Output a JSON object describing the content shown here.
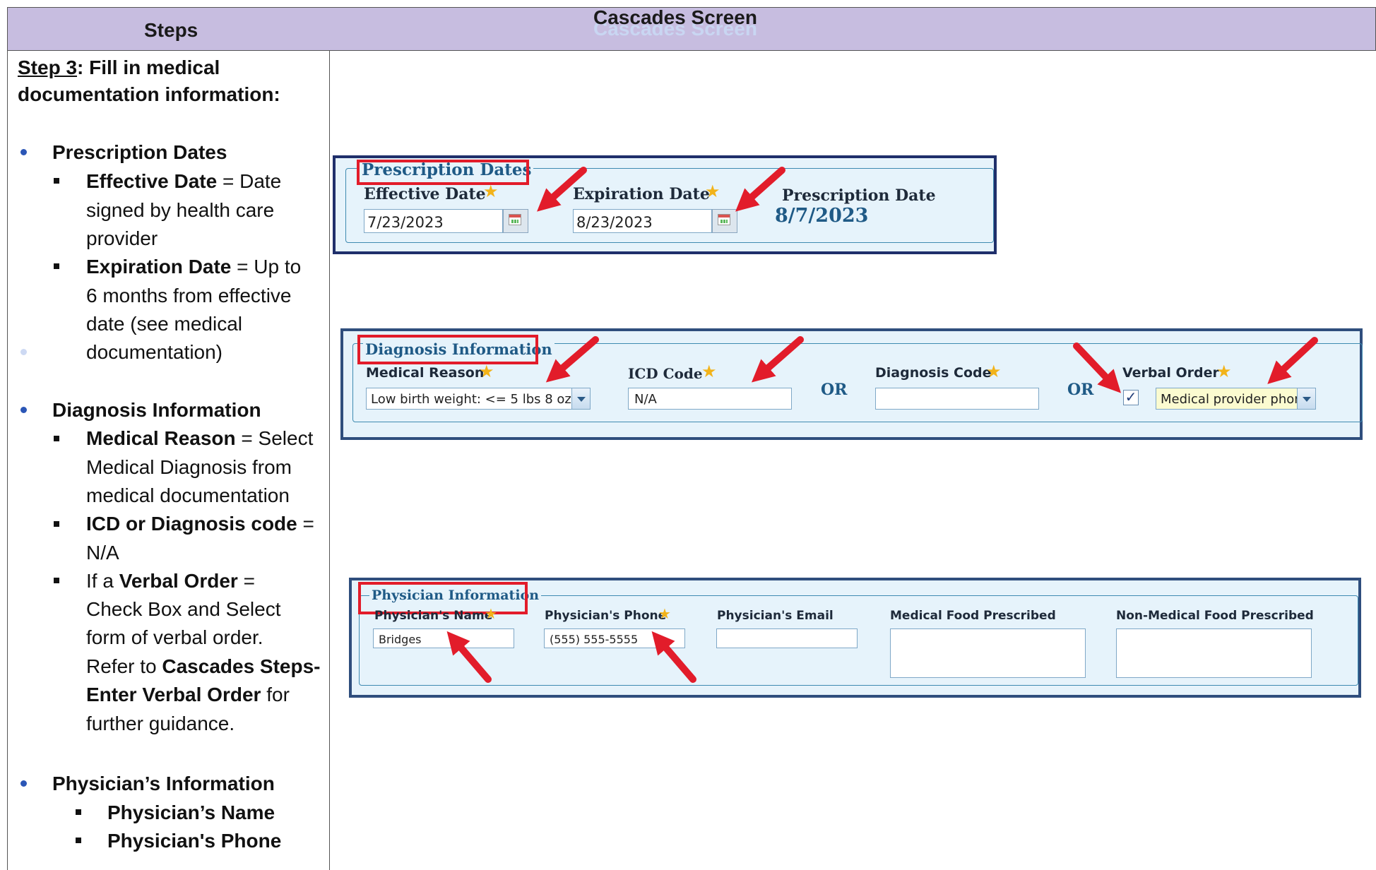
{
  "header": {
    "steps": "Steps",
    "screen": "Cascades Screen"
  },
  "left": {
    "step_label": "Step 3",
    "step_rest": ": Fill in medical",
    "step_line2": "documentation information:",
    "rx_dates": "Prescription Dates",
    "eff_bold": "Effective Date",
    "eff_rest": " = Date",
    "eff_l2": "signed by health care",
    "eff_l3": "provider",
    "exp_bold": "Expiration Date",
    "exp_rest": " = Up to",
    "exp_l2": "6 months from effective",
    "exp_l3": "date (see medical",
    "exp_l4": "documentation)",
    "diag_info": "Diagnosis Information",
    "mr_bold": "Medical Reason",
    "mr_rest": " = Select",
    "mr_l2": "Medical Diagnosis from",
    "mr_l3": "medical documentation",
    "icd_bold": "ICD or Diagnosis code",
    "icd_rest": " =",
    "icd_l2": "N/A",
    "vo_pre": "If a ",
    "vo_bold": "Verbal Order",
    "vo_rest": " =",
    "vo_l2": "Check Box and Select",
    "vo_l3": "form of verbal order.",
    "vo_l4_pre": "Refer to ",
    "vo_l4_bold": "Cascades Steps-",
    "vo_l5_bold": "Enter Verbal Order",
    "vo_l5_rest": " for",
    "vo_l6": "further guidance.",
    "phys_info": "Physician’s Information",
    "phys_name": "Physician’s Name",
    "phys_phone": "Physician's Phone"
  },
  "rx_panel": {
    "legend": "Prescription Dates",
    "effective_label": "Effective Date",
    "effective_value": "7/23/2023",
    "expiration_label": "Expiration Date",
    "expiration_value": "8/23/2023",
    "prescription_label": "Prescription Date",
    "prescription_value": "8/7/2023"
  },
  "diag_panel": {
    "legend": "Diagnosis Information",
    "medical_reason_label": "Medical Reason",
    "medical_reason_value": "Low birth weight: <= 5 lbs 8 oz",
    "icd_label": "ICD Code",
    "icd_value": "N/A",
    "or1": "OR",
    "diagnosis_code_label": "Diagnosis Code",
    "diagnosis_code_value": "",
    "or2": "OR",
    "verbal_order_label": "Verbal Order",
    "verbal_order_checked": "✓",
    "verbal_order_value": "Medical provider phon"
  },
  "phys_panel": {
    "legend": "Physician Information",
    "name_label": "Physician's Name",
    "name_value": "Bridges",
    "phone_label": "Physician's Phone",
    "phone_value": "(555) 555-5555",
    "email_label": "Physician's Email",
    "email_value": "",
    "med_food_label": "Medical Food Prescribed",
    "nonmed_food_label": "Non-Medical Food Prescribed"
  },
  "colors": {
    "header_bg": "#c7bde0",
    "arrow": "#e21c2a",
    "panel_border": "#1f2f6b",
    "panel_bg": "#e6f3fb"
  }
}
